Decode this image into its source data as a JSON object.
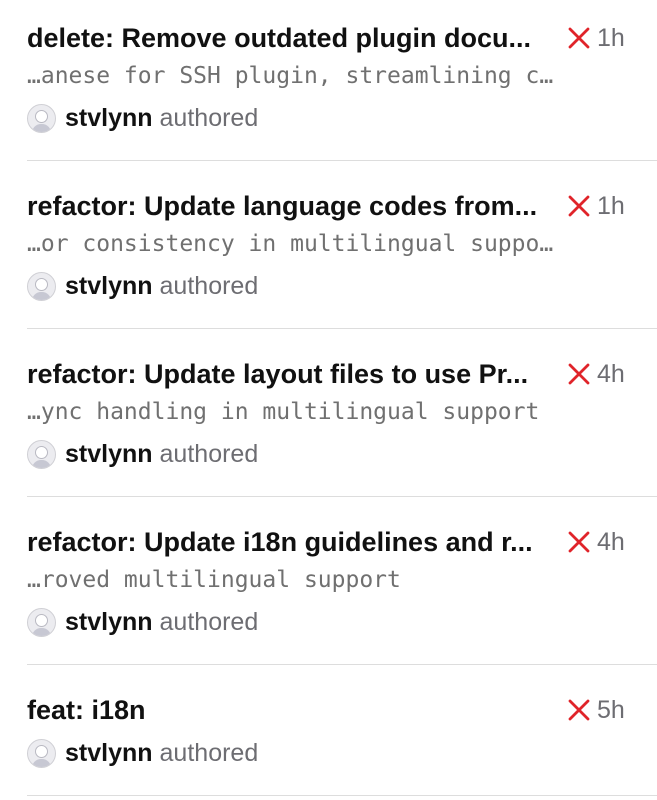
{
  "commits": [
    {
      "title": "delete: Remove outdated plugin docu...",
      "description": "…anese for SSH plugin, streamlining c…",
      "author": "stvlynn",
      "action": "authored",
      "status": "failed",
      "time": "1h"
    },
    {
      "title": "refactor: Update language codes from...",
      "description": "…or consistency in multilingual suppo…",
      "author": "stvlynn",
      "action": "authored",
      "status": "failed",
      "time": "1h"
    },
    {
      "title": "refactor: Update layout files to use Pr...",
      "description": "…ync handling in multilingual support",
      "author": "stvlynn",
      "action": "authored",
      "status": "failed",
      "time": "4h"
    },
    {
      "title": "refactor: Update i18n guidelines and r...",
      "description": "…roved multilingual support",
      "author": "stvlynn",
      "action": "authored",
      "status": "failed",
      "time": "4h"
    },
    {
      "title": "feat: i18n",
      "description": "",
      "author": "stvlynn",
      "action": "authored",
      "status": "failed",
      "time": "5h"
    }
  ],
  "colors": {
    "failed_icon": "#e0242a",
    "secondary_text": "#6d6d72",
    "separator": "#dddddd"
  }
}
